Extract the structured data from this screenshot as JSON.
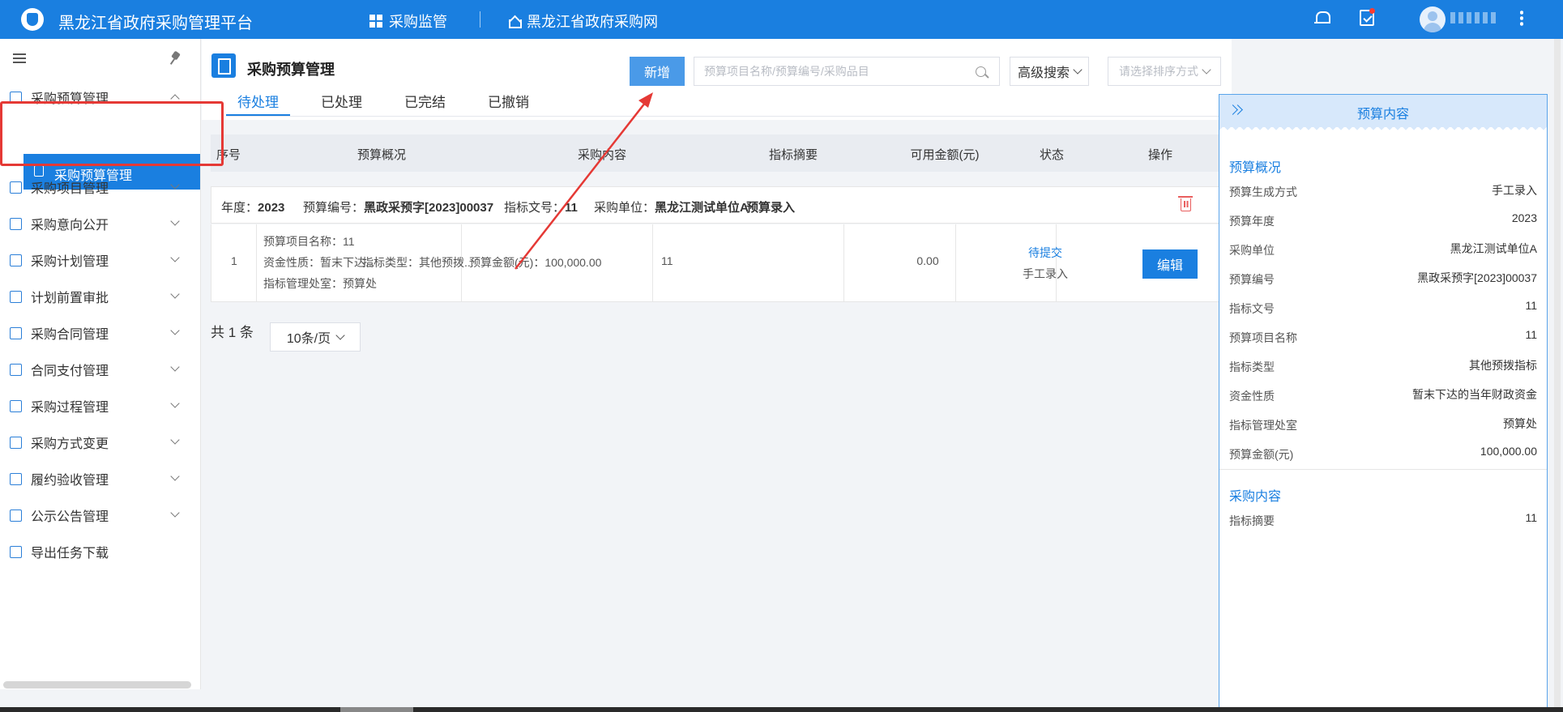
{
  "header": {
    "app_title": "黑龙江省政府采购管理平台",
    "nav": [
      {
        "label": "采购监管",
        "icon": "grid-icon"
      },
      {
        "label": "黑龙江省政府采购网",
        "icon": "home-icon"
      }
    ],
    "username": "-------"
  },
  "sidebar": {
    "items": [
      {
        "label": "采购预算管理",
        "expanded": true
      },
      {
        "label": "采购项目管理"
      },
      {
        "label": "采购意向公开"
      },
      {
        "label": "采购计划管理"
      },
      {
        "label": "计划前置审批"
      },
      {
        "label": "采购合同管理"
      },
      {
        "label": "合同支付管理"
      },
      {
        "label": "采购过程管理"
      },
      {
        "label": "采购方式变更"
      },
      {
        "label": "履约验收管理"
      },
      {
        "label": "公示公告管理"
      },
      {
        "label": "导出任务下载"
      }
    ],
    "active_sub": "采购预算管理"
  },
  "page": {
    "title": "采购预算管理",
    "add_label": "新增",
    "search_placeholder": "预算项目名称/预算编号/采购品目",
    "advanced_label": "高级搜索",
    "sort_placeholder": "请选择排序方式",
    "tabs": [
      "待处理",
      "已处理",
      "已完结",
      "已撤销"
    ],
    "active_tab": 0
  },
  "table": {
    "headers": [
      "序号",
      "预算概况",
      "采购内容",
      "指标摘要",
      "可用金额(元)",
      "状态",
      "操作"
    ],
    "group": {
      "year_label": "年度：",
      "year": "2023",
      "budget_no_label": "预算编号：",
      "budget_no": "黑政采预字[2023]00037",
      "index_doc_label": "指标文号：",
      "index_doc": "11",
      "unit_label": "采购单位：",
      "unit": "黑龙江测试单位A",
      "entry": "预算录入"
    },
    "row": {
      "index": "1",
      "summary_name": "预算项目名称：11",
      "summary_fund": "资金性质：暂末下达...",
      "summary_type": "指标类型：其他预拨...",
      "summary_office": "指标管理处室：预算处",
      "content": "预算金额(元)：100,000.00",
      "index_summary": "11",
      "available": "0.00",
      "status": "待提交",
      "status_sub": "手工录入",
      "action": "编辑"
    }
  },
  "pager": {
    "total": "共 1 条",
    "page_size": "10条/页"
  },
  "detail_panel": {
    "title": "预算内容",
    "section1": "预算概况",
    "fields": [
      {
        "label": "预算生成方式",
        "value": "手工录入"
      },
      {
        "label": "预算年度",
        "value": "2023"
      },
      {
        "label": "采购单位",
        "value": "黑龙江测试单位A"
      },
      {
        "label": "预算编号",
        "value": "黑政采预字[2023]00037"
      },
      {
        "label": "指标文号",
        "value": "11"
      },
      {
        "label": "预算项目名称",
        "value": "11"
      },
      {
        "label": "指标类型",
        "value": "其他预拨指标"
      },
      {
        "label": "资金性质",
        "value": "暂末下达的当年财政资金"
      },
      {
        "label": "指标管理处室",
        "value": "预算处"
      },
      {
        "label": "预算金额(元)",
        "value": "100,000.00"
      }
    ],
    "section2": "采购内容",
    "fields2": [
      {
        "label": "指标摘要",
        "value": "11"
      }
    ]
  },
  "colors": {
    "primary": "#1a7fe0",
    "annotation": "#e53935"
  }
}
